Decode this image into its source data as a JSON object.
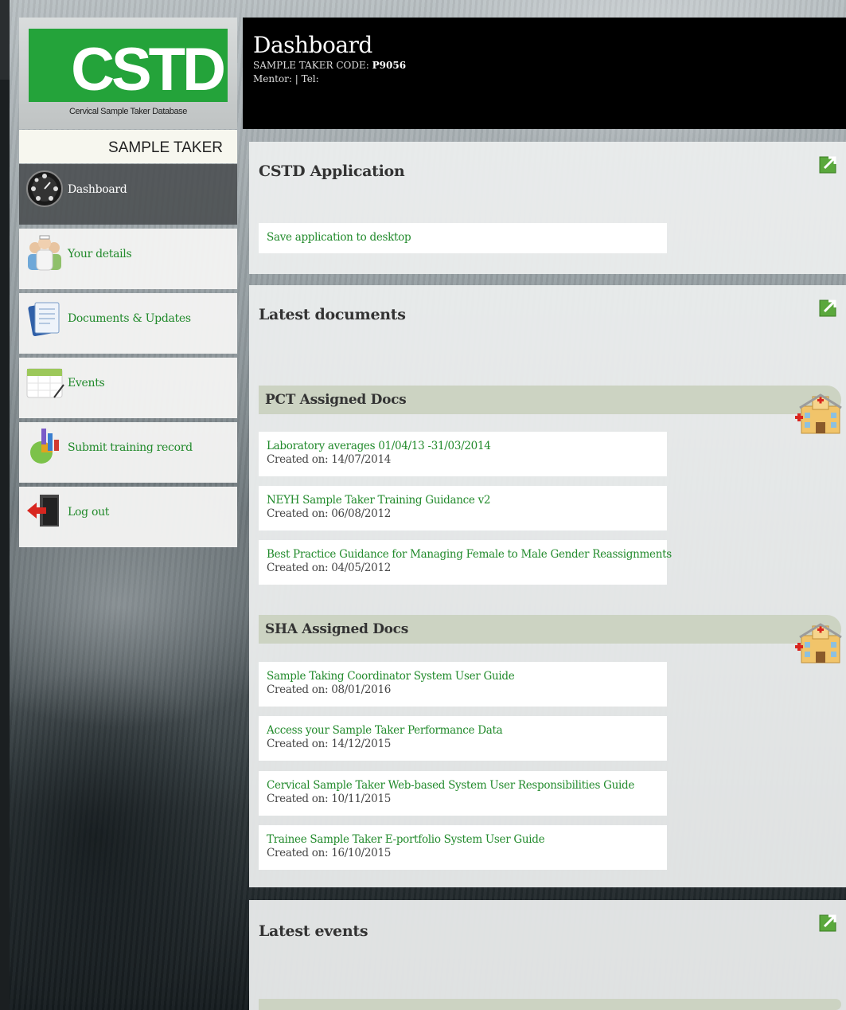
{
  "brand": {
    "logo_text": "CSTD",
    "logo_subtitle": "Cervical Sample Taker Database",
    "role": "SAMPLE TAKER"
  },
  "sidebar": {
    "items": [
      {
        "label": "Dashboard",
        "icon": "dashboard-icon",
        "active": true
      },
      {
        "label": "Your details",
        "icon": "people-icon"
      },
      {
        "label": "Documents & Updates",
        "icon": "documents-icon"
      },
      {
        "label": "Events",
        "icon": "calendar-icon"
      },
      {
        "label": "Submit training record",
        "icon": "chart-icon"
      },
      {
        "label": "Log out",
        "icon": "logout-door-icon"
      }
    ]
  },
  "header": {
    "title": "Dashboard",
    "code_label": "SAMPLE TAKER CODE:",
    "code_value": "P9056",
    "mentor_line": "Mentor: | Tel:"
  },
  "application": {
    "title": "CSTD Application",
    "link": "Save application to desktop"
  },
  "documents": {
    "title": "Latest documents",
    "created_label": "Created on:",
    "groups": [
      {
        "name": "PCT Assigned Docs",
        "docs": [
          {
            "title": "Laboratory averages 01/04/13 -31/03/2014",
            "created": "Created on: 14/07/2014"
          },
          {
            "title": "NEYH Sample Taker Training Guidance v2",
            "created": "Created on: 06/08/2012"
          },
          {
            "title": "Best Practice Guidance for Managing Female to Male Gender Reassignments",
            "created": "Created on: 04/05/2012"
          }
        ]
      },
      {
        "name": "SHA Assigned Docs",
        "docs": [
          {
            "title": "Sample Taking Coordinator System User Guide",
            "created": "Created on: 08/01/2016"
          },
          {
            "title": "Access your Sample Taker Performance Data",
            "created": "Created on: 14/12/2015"
          },
          {
            "title": "Cervical Sample Taker Web-based System User Responsibilities Guide",
            "created": "Created on: 10/11/2015"
          },
          {
            "title": "Trainee Sample Taker E-portfolio System User Guide",
            "created": "Created on: 16/10/2015"
          }
        ]
      }
    ]
  },
  "events": {
    "title": "Latest events"
  },
  "colors": {
    "link_green": "#218a2b",
    "logo_green": "#24a33a",
    "header_black": "#000000",
    "group_bar": "#ccd3c2"
  }
}
